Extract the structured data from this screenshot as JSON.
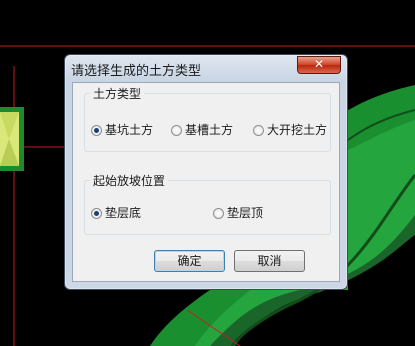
{
  "dialog": {
    "title": "请选择生成的土方类型",
    "close_glyph": "✕",
    "earthwork_group": {
      "label": "土方类型",
      "options": [
        {
          "label": "基坑土方",
          "checked": true
        },
        {
          "label": "基槽土方",
          "checked": false
        },
        {
          "label": "大开挖土方",
          "checked": false
        }
      ]
    },
    "slope_group": {
      "label": "起始放坡位置",
      "options": [
        {
          "label": "垫层底",
          "checked": true
        },
        {
          "label": "垫层顶",
          "checked": false
        }
      ]
    },
    "buttons": {
      "ok": "确定",
      "cancel": "取消"
    }
  },
  "colors": {
    "canvas_background": "#000000",
    "curve_green": "#1a8f2f",
    "curve_light_green": "#2fb84a",
    "cad_red_line": "#c81e1e",
    "block_yellow_green": "#d9e878",
    "block_border_green": "#1d8a2f"
  }
}
